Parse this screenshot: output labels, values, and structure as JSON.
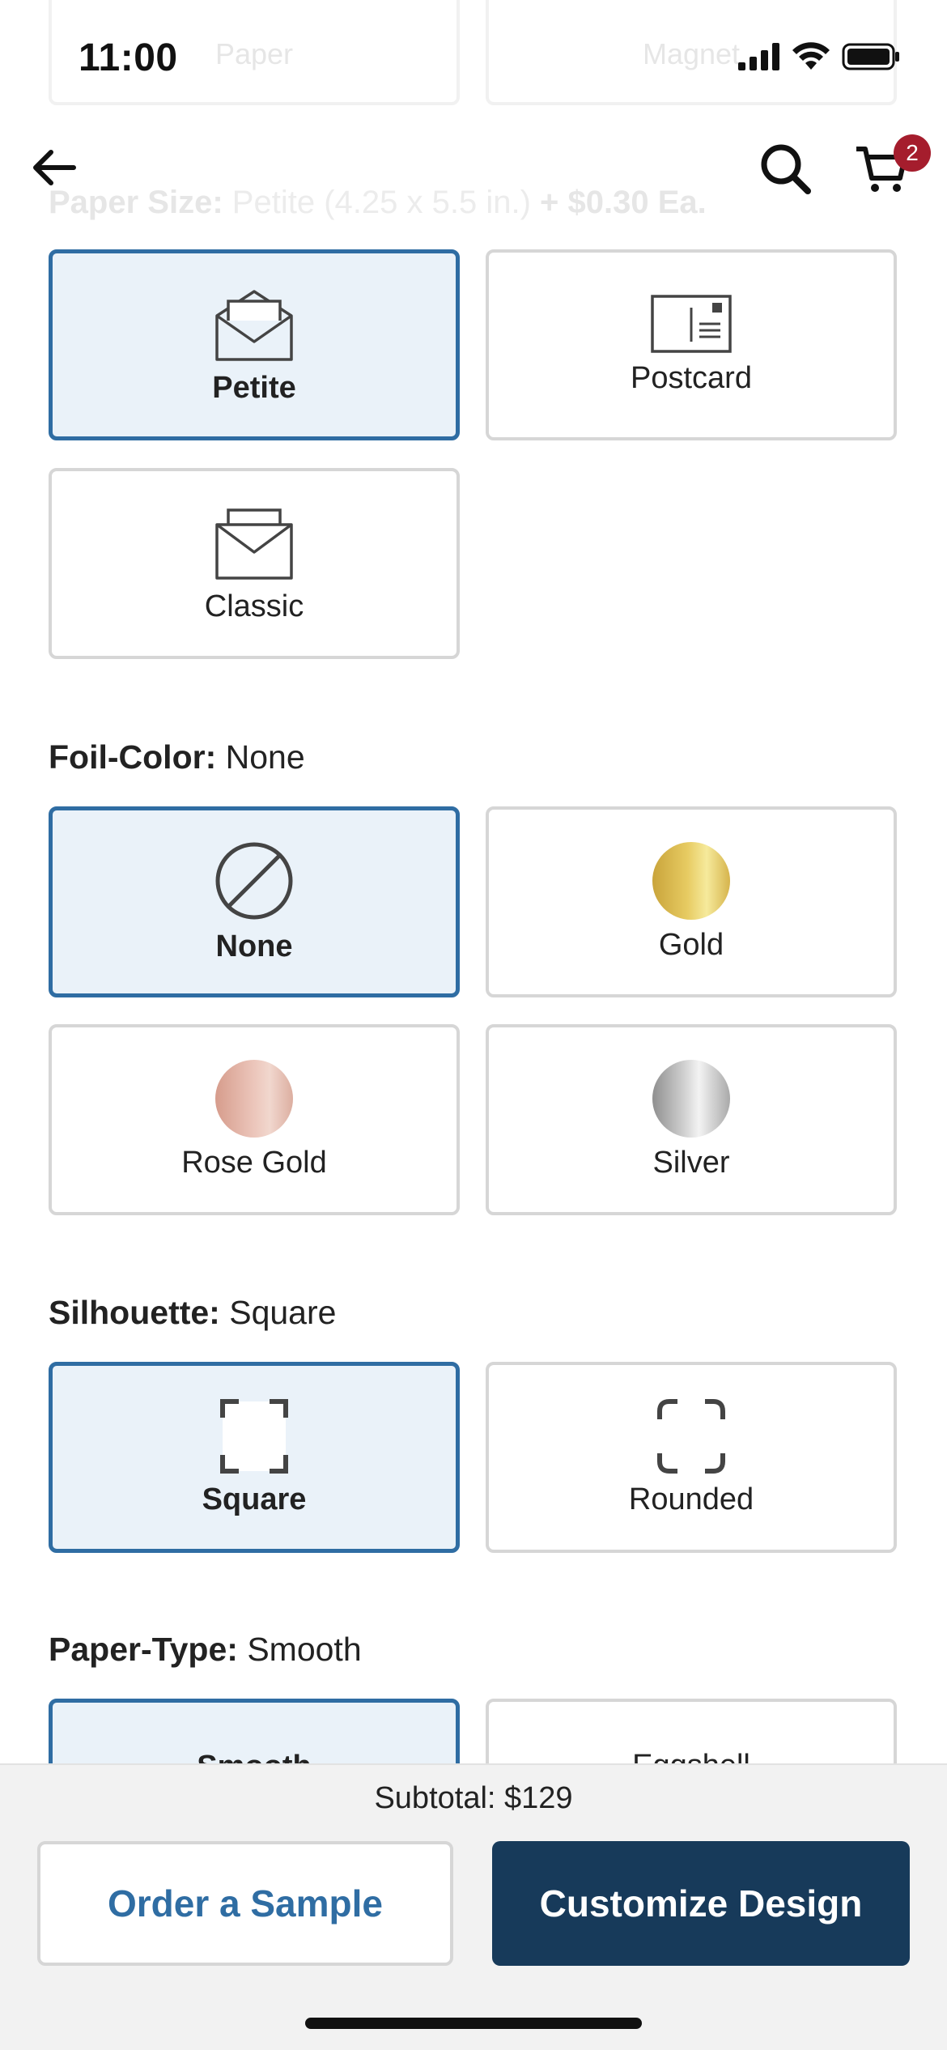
{
  "status": {
    "time": "11:00"
  },
  "ghost": {
    "paper_label": "Paper",
    "magnet_label": "Magnet",
    "line_label": "Paper Size:",
    "line_value": "Petite",
    "line_dims": "(4.25 x 5.5 in.)",
    "line_price": "+ $0.30 Ea."
  },
  "nav": {
    "cart_count": "2"
  },
  "paper_size": {
    "options": [
      {
        "label": "Petite",
        "icon": "open-envelope-icon",
        "selected": true
      },
      {
        "label": "Postcard",
        "icon": "postcard-icon",
        "selected": false
      },
      {
        "label": "Classic",
        "icon": "envelope-card-icon",
        "selected": false
      }
    ]
  },
  "foil_color": {
    "title": "Foil-Color:",
    "value": "None",
    "options": [
      {
        "label": "None",
        "icon": "no-symbol-icon",
        "selected": true
      },
      {
        "label": "Gold",
        "icon": "gold-swatch",
        "selected": false,
        "color": "#d8b74e"
      },
      {
        "label": "Rose Gold",
        "icon": "rose-gold-swatch",
        "selected": false,
        "color": "#dfb2a4"
      },
      {
        "label": "Silver",
        "icon": "silver-swatch",
        "selected": false,
        "color": "#b8b8b8"
      }
    ]
  },
  "silhouette": {
    "title": "Silhouette:",
    "value": "Square",
    "options": [
      {
        "label": "Square",
        "icon": "square-corners-icon",
        "selected": true
      },
      {
        "label": "Rounded",
        "icon": "rounded-corners-icon",
        "selected": false
      }
    ]
  },
  "paper_type": {
    "title": "Paper-Type:",
    "value": "Smooth",
    "options": [
      {
        "label": "Smooth",
        "selected": true
      },
      {
        "label": "Eggshell",
        "selected": false
      }
    ]
  },
  "footer": {
    "subtotal": "Subtotal: $129",
    "order_sample": "Order a Sample",
    "customize": "Customize Design"
  },
  "colors": {
    "accent": "#2f6da3",
    "primary_button": "#173a5a",
    "badge": "#a51d2d"
  }
}
